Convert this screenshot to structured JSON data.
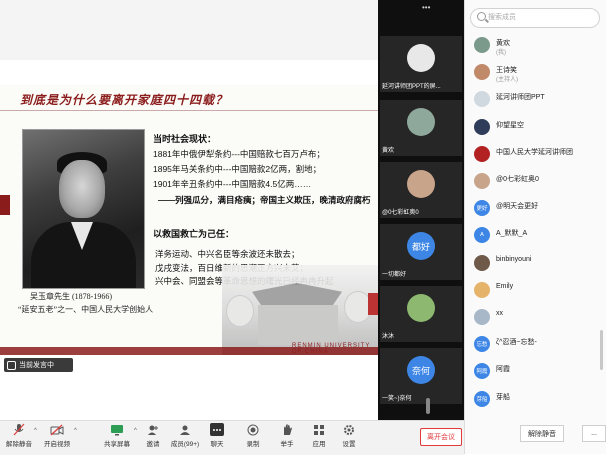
{
  "slide": {
    "question": "到底是为什么要离开家庭四十四载？",
    "caption_name": "吴玉章先生  (1878-1966)",
    "caption_title": "“延安五老”之一、中国人民大学创始人",
    "heading1": "当时社会现状：",
    "line1": "1881年中俄伊犁条约---中国赔款七百万卢布；",
    "line2": "1895年马关条约中---中国赔款2亿两，割地；",
    "line3": "1901年辛丑条约中---中国赔款4.5亿两……",
    "line4": "——列强瓜分，满目疮痍；帝国主义欺压，晚清政府腐朽",
    "heading2": "以救国救亡为己任：",
    "line5": "洋务运动、中兴名臣等余波还未散去；",
    "line6": "戊戌变法，百日维新的思潮正方兴未艾；",
    "line7": "兴中会、同盟会等革命思想的曙光已经冉冉升起",
    "university": "RENMIN UNIVERSITY OF CHINA"
  },
  "speaking": "当前发言中",
  "video_tiles": [
    {
      "name": "延河讲师团PPT的屏...",
      "avatar_text": "",
      "color": "#e8e8e8"
    },
    {
      "name": "黄欢",
      "avatar_text": "",
      "color": "#8fa89c"
    },
    {
      "name": "@0七彩虹奥0",
      "avatar_text": "",
      "color": "#c7a48a"
    },
    {
      "name": "一切都好",
      "avatar_text": "都好",
      "color": "#3d86e6"
    },
    {
      "name": "沐沐",
      "avatar_text": "",
      "color": "#8db870"
    },
    {
      "name": "一笑~)奈何",
      "avatar_text": "奈何",
      "color": "#3d86e6"
    }
  ],
  "panel": {
    "search_placeholder": "搜索成员",
    "participants": [
      {
        "name": "黄欢",
        "sub": "(我)",
        "avatar_text": "",
        "color": "#7c9a8c"
      },
      {
        "name": "王诗笑",
        "sub": "(主持人)",
        "avatar_text": "",
        "color": "#c08a6a"
      },
      {
        "name": "延河讲师团PPT",
        "sub": "",
        "avatar_text": "",
        "color": "#d0d8e0"
      },
      {
        "name": "仰望星空",
        "sub": "",
        "avatar_text": "",
        "color": "#2f3d5a"
      },
      {
        "name": "中国人民大学延河讲师团",
        "sub": "",
        "avatar_text": "",
        "color": "#b22222"
      },
      {
        "name": "@0七彩虹奥0",
        "sub": "",
        "avatar_text": "",
        "color": "#c7a48a"
      },
      {
        "name": "@明天会更好",
        "sub": "",
        "avatar_text": "更好",
        "color": "#3d86e6"
      },
      {
        "name": "A_默默_A",
        "sub": "",
        "avatar_text": "A",
        "color": "#3d86e6"
      },
      {
        "name": "binbinyouni",
        "sub": "",
        "avatar_text": "",
        "color": "#6f5a4a"
      },
      {
        "name": "Emily",
        "sub": "",
        "avatar_text": "",
        "color": "#e6b36a"
      },
      {
        "name": "xx",
        "sub": "",
        "avatar_text": "",
        "color": "#a8b8c8"
      },
      {
        "name": "ζ^忍酒~忘愁-",
        "sub": "",
        "avatar_text": "忘愁",
        "color": "#3d86e6"
      },
      {
        "name": "阿霞",
        "sub": "",
        "avatar_text": "阿霞",
        "color": "#3d86e6"
      },
      {
        "name": "芽船",
        "sub": "",
        "avatar_text": "芽船",
        "color": "#3d86e6"
      }
    ],
    "unmute_all": "解除静音",
    "more": "..."
  },
  "toolbar": {
    "mute": "解除静音",
    "video": "开启视频",
    "share": "共享屏幕",
    "invite": "邀请",
    "members": "成员(99+)",
    "chat": "聊天",
    "record": "录制",
    "raise": "举手",
    "apps": "应用",
    "settings": "设置",
    "leave": "离开会议"
  }
}
